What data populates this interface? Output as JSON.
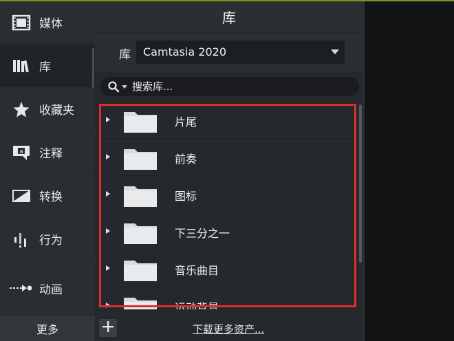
{
  "nav": {
    "items": [
      {
        "label": "媒体",
        "icon": "film-icon"
      },
      {
        "label": "库",
        "icon": "library-books-icon",
        "active": true
      },
      {
        "label": "收藏夹",
        "icon": "star-icon"
      },
      {
        "label": "注释",
        "icon": "annotation-icon"
      },
      {
        "label": "转换",
        "icon": "transition-icon"
      },
      {
        "label": "行为",
        "icon": "behavior-icon"
      },
      {
        "label": "动画",
        "icon": "animation-arrow-icon"
      }
    ],
    "more_label": "更多"
  },
  "panel": {
    "title": "库",
    "library_label": "库",
    "library_selected": "Camtasia 2020",
    "search_placeholder": "搜索库..."
  },
  "folders": [
    {
      "label": "片尾"
    },
    {
      "label": "前奏"
    },
    {
      "label": "图标"
    },
    {
      "label": "下三分之一"
    },
    {
      "label": "音乐曲目"
    },
    {
      "label": "运动背景"
    }
  ],
  "footer": {
    "download_label": "下载更多资产..."
  },
  "colors": {
    "highlight": "#e02d2d",
    "accent": "#6f9a1e"
  }
}
